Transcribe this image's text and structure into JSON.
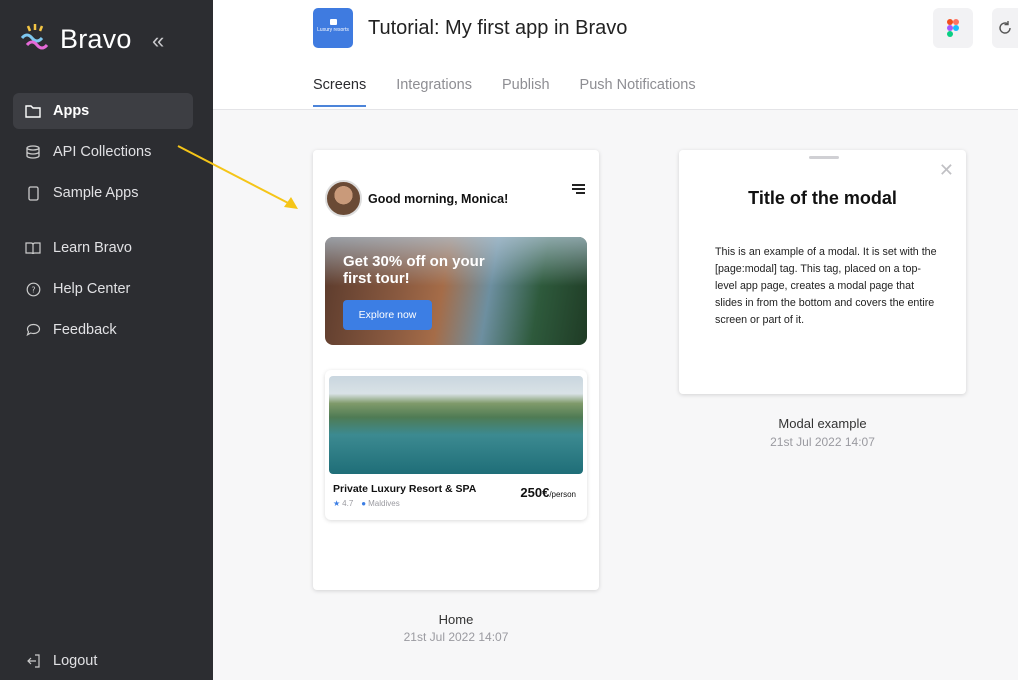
{
  "sidebar": {
    "brand": "Bravo",
    "items": [
      {
        "label": "Apps"
      },
      {
        "label": "API Collections"
      },
      {
        "label": "Sample Apps"
      },
      {
        "label": "Learn Bravo"
      },
      {
        "label": "Help Center"
      },
      {
        "label": "Feedback"
      }
    ],
    "logout": "Logout"
  },
  "header": {
    "app_icon_text": "Luxury resorts",
    "title": "Tutorial: My first app in Bravo",
    "tabs": [
      {
        "label": "Screens"
      },
      {
        "label": "Integrations"
      },
      {
        "label": "Publish"
      },
      {
        "label": "Push Notifications"
      }
    ]
  },
  "screens": [
    {
      "name": "Home",
      "date": "21st Jul 2022 14:07",
      "preview": {
        "greeting": "Good morning, Monica!",
        "promo_text": "Get 30% off on your first tour!",
        "promo_button": "Explore now",
        "resort_name": "Private Luxury Resort & SPA",
        "rating": "4.7",
        "location": "Maldives",
        "price": "250€",
        "price_unit": "/person"
      }
    },
    {
      "name": "Modal example",
      "date": "21st Jul 2022 14:07",
      "preview": {
        "title": "Title of the modal",
        "body": "This is an example of a modal. It is set with the [page:modal] tag. This tag, placed on a top-level app page, creates a modal page that slides in from the bottom and covers the entire screen or part of it."
      }
    }
  ],
  "colors": {
    "sidebar_bg": "#2c2d31",
    "accent": "#4c84d9",
    "arrow": "#f5c518"
  }
}
